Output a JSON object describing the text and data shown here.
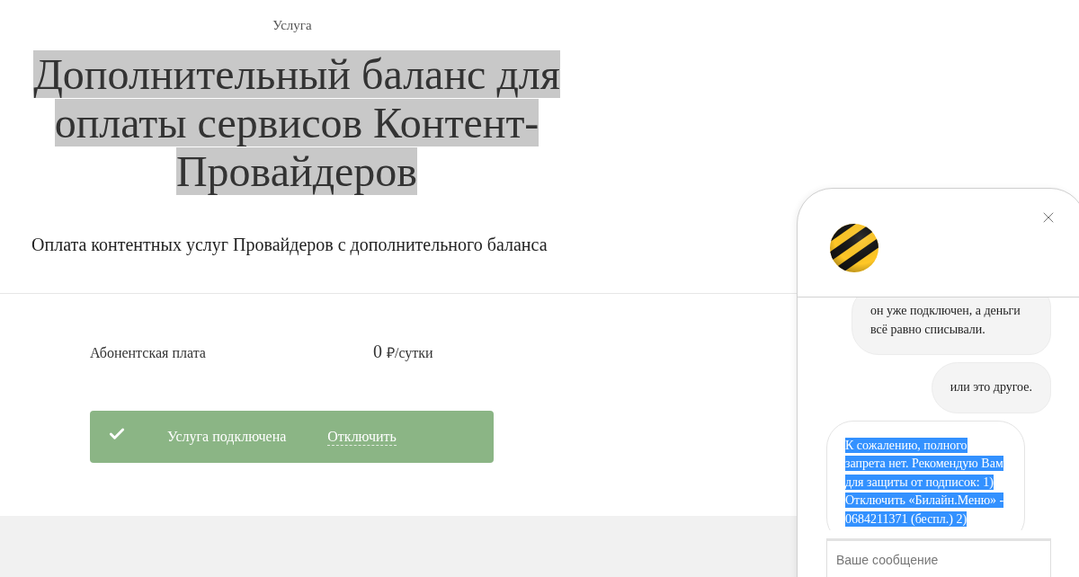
{
  "header": {
    "eyebrow": "Услуга",
    "title": "Дополнительный баланс для оплаты сервисов Контент-Провайдеров",
    "title_highlighted": true,
    "description": "Оплата контентных услуг Провайдеров с дополнительного баланса"
  },
  "fee": {
    "label": "Абонентская плата",
    "value": "0",
    "unit": "₽/сутки"
  },
  "status": {
    "connected": true,
    "label": "Услуга подключена",
    "action": "Отключить"
  },
  "chat": {
    "messages": [
      {
        "kind": "user",
        "text": "он уже подключен, а деньги всё равно списывали.",
        "highlighted": false
      },
      {
        "kind": "user",
        "text": "или это другое.",
        "highlighted": false
      },
      {
        "kind": "bot",
        "text": "К сожалению, полного запрета нет. Рекомендую Вам для защиты от подписок: 1) Отключить «Билайн.Меню» - 0684211371 (беспл.) 2)",
        "highlighted": true
      }
    ],
    "input": {
      "placeholder": "Ваше сообщение"
    }
  }
}
